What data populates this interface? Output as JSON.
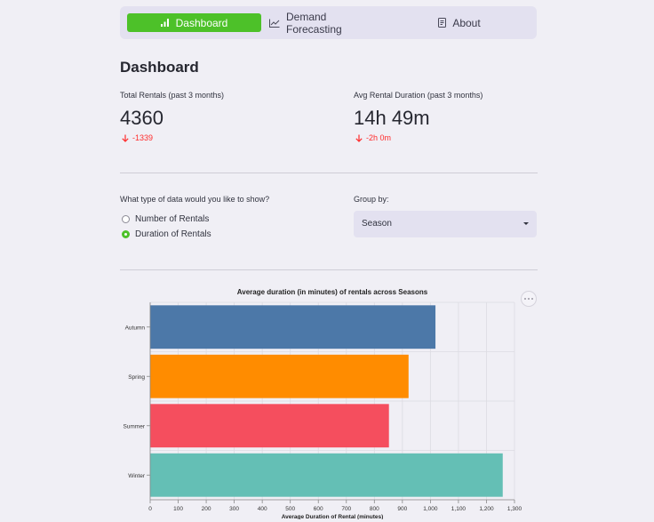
{
  "nav": {
    "items": [
      {
        "label": "Dashboard",
        "icon": "bar-chart-icon",
        "active": true
      },
      {
        "label": "Demand Forecasting",
        "icon": "line-chart-icon",
        "active": false
      },
      {
        "label": "About",
        "icon": "document-icon",
        "active": false
      }
    ],
    "active_color": "#4dc129"
  },
  "page": {
    "title": "Dashboard"
  },
  "metrics": [
    {
      "label": "Total Rentals (past 3 months)",
      "value": "4360",
      "delta": "-1339",
      "delta_icon": "arrow-down-icon",
      "delta_color": "#ff2b2b"
    },
    {
      "label": "Avg Rental Duration (past 3 months)",
      "value": "14h 49m",
      "delta": "-2h 0m",
      "delta_icon": "arrow-down-icon",
      "delta_color": "#ff2b2b"
    }
  ],
  "data_type": {
    "question": "What type of data would you like to show?",
    "options": [
      "Number of Rentals",
      "Duration of Rentals"
    ],
    "selected": "Duration of Rentals"
  },
  "group_by": {
    "label": "Group by:",
    "value": "Season"
  },
  "chart_data": {
    "type": "bar",
    "orientation": "horizontal",
    "title": "Average duration (in minutes) of rentals across Seasons",
    "xlabel": "Average Duration of Rental (minutes)",
    "ylabel": "",
    "categories": [
      "Autumn",
      "Spring",
      "Summer",
      "Winter"
    ],
    "values": [
      1018,
      922,
      852,
      1258
    ],
    "colors": [
      "#4c78a8",
      "#ff8c00",
      "#f54e5e",
      "#64bfb5"
    ],
    "xlim": [
      0,
      1300
    ],
    "xticks": [
      0,
      100,
      200,
      300,
      400,
      500,
      600,
      700,
      800,
      900,
      1000,
      1100,
      1200,
      1300
    ],
    "xtick_labels": [
      "0",
      "100",
      "200",
      "300",
      "400",
      "500",
      "600",
      "700",
      "800",
      "900",
      "1,000",
      "1,100",
      "1,200",
      "1,300"
    ],
    "grid": true,
    "legend": "none"
  }
}
